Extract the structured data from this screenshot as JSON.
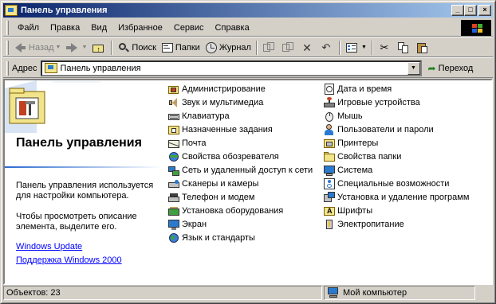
{
  "window": {
    "title": "Панель управления",
    "buttons": {
      "minimize": "_",
      "maximize": "□",
      "close": "×"
    }
  },
  "menu": {
    "items": [
      "Файл",
      "Правка",
      "Вид",
      "Избранное",
      "Сервис",
      "Справка"
    ]
  },
  "toolbar": {
    "back_label": "Назад",
    "search_label": "Поиск",
    "folders_label": "Папки",
    "history_label": "Журнал"
  },
  "address": {
    "label": "Адрес",
    "value": "Панель управления",
    "go_label": "Переход"
  },
  "left_panel": {
    "title": "Панель управления",
    "description": "Панель управления используется для настройки компьютера.",
    "hint": "Чтобы просмотреть описание элемента, выделите его.",
    "links": [
      "Windows Update",
      "Поддержка Windows 2000"
    ]
  },
  "items": {
    "column1": [
      {
        "label": "Администрирование",
        "icon": "admin-tools-icon"
      },
      {
        "label": "Звук и мультимедиа",
        "icon": "sound-icon"
      },
      {
        "label": "Клавиатура",
        "icon": "keyboard-icon"
      },
      {
        "label": "Назначенные задания",
        "icon": "scheduled-tasks-icon"
      },
      {
        "label": "Почта",
        "icon": "mail-icon"
      },
      {
        "label": "Свойства обозревателя",
        "icon": "internet-options-icon"
      },
      {
        "label": "Сеть и удаленный доступ к сети",
        "icon": "network-icon"
      },
      {
        "label": "Сканеры и камеры",
        "icon": "scanner-icon"
      },
      {
        "label": "Телефон и модем",
        "icon": "phone-modem-icon"
      },
      {
        "label": "Установка оборудования",
        "icon": "hardware-icon"
      },
      {
        "label": "Экран",
        "icon": "display-icon"
      },
      {
        "label": "Язык и стандарты",
        "icon": "regional-icon"
      }
    ],
    "column2": [
      {
        "label": "Дата и время",
        "icon": "date-time-icon"
      },
      {
        "label": "Игровые устройства",
        "icon": "game-controller-icon"
      },
      {
        "label": "Мышь",
        "icon": "mouse-icon"
      },
      {
        "label": "Пользователи и пароли",
        "icon": "users-icon"
      },
      {
        "label": "Принтеры",
        "icon": "printer-icon"
      },
      {
        "label": "Свойства папки",
        "icon": "folder-options-icon"
      },
      {
        "label": "Система",
        "icon": "system-icon"
      },
      {
        "label": "Специальные возможности",
        "icon": "accessibility-icon"
      },
      {
        "label": "Установка и удаление программ",
        "icon": "add-remove-icon"
      },
      {
        "label": "Шрифты",
        "icon": "fonts-icon"
      },
      {
        "label": "Электропитание",
        "icon": "power-icon"
      }
    ]
  },
  "status": {
    "objects": "Объектов: 23",
    "location": "Мой компьютер"
  },
  "colors": {
    "title_start": "#0a246a",
    "title_end": "#a6caf0",
    "face": "#d4d0c8",
    "link": "#0000ff"
  }
}
